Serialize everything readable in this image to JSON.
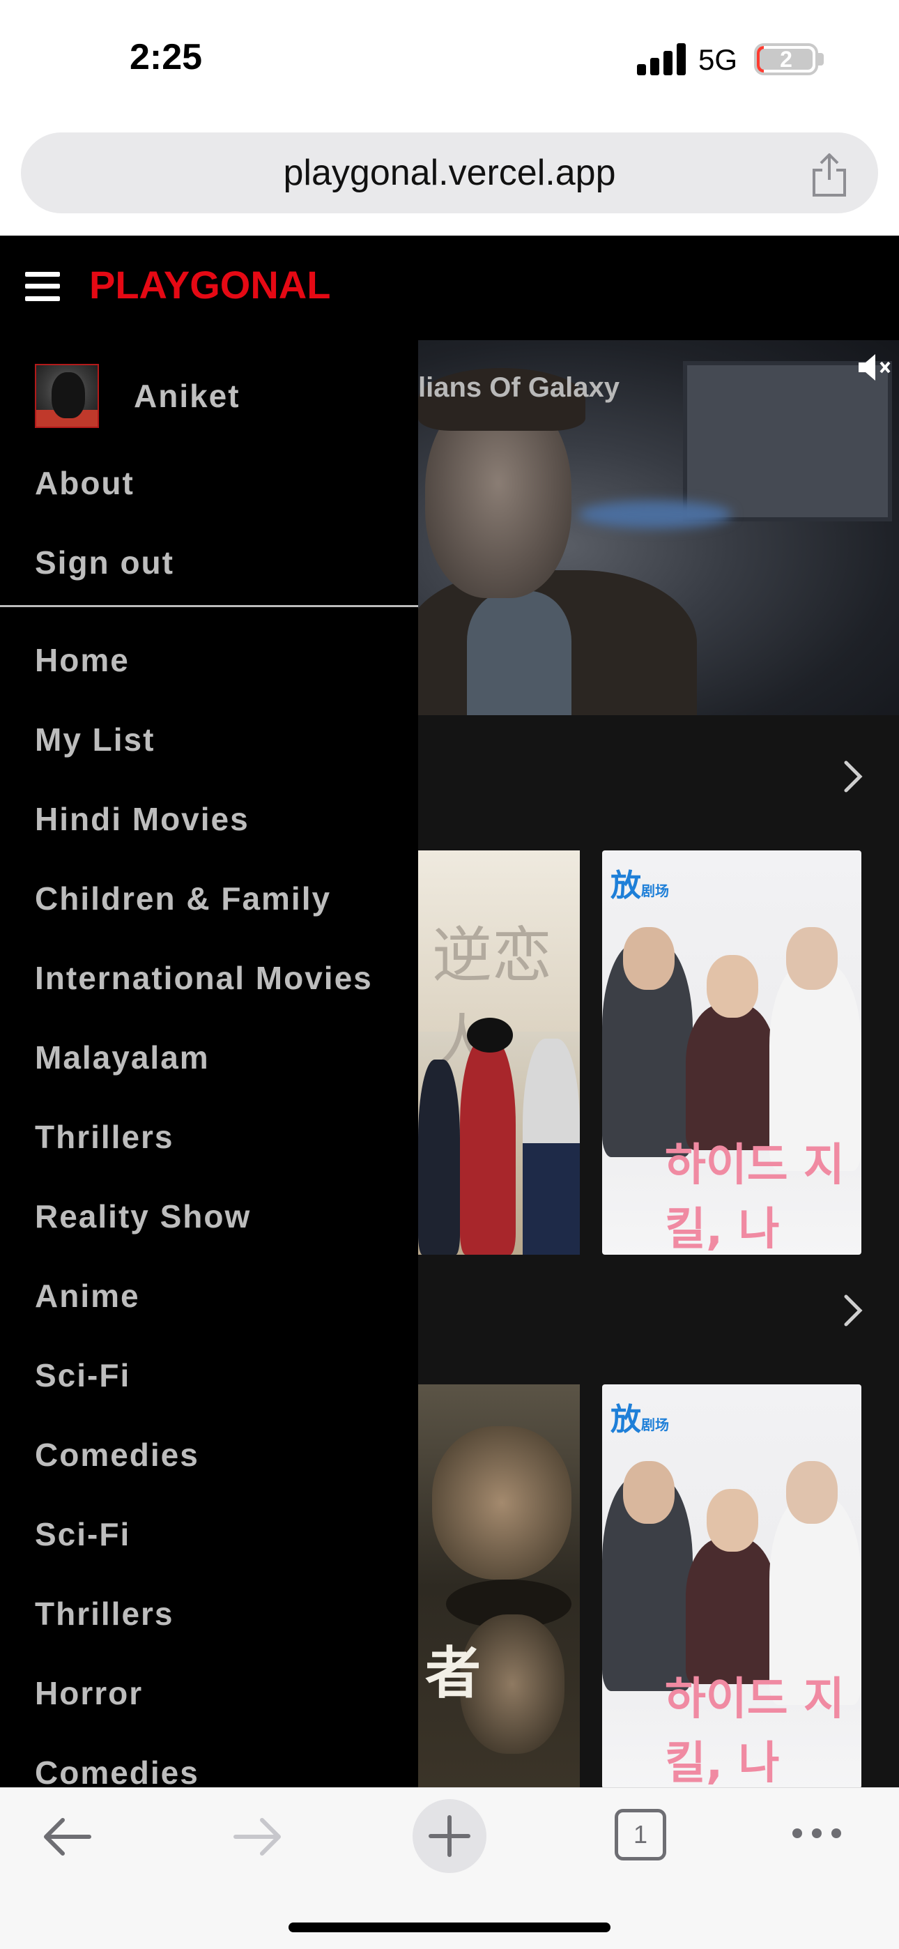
{
  "status_bar": {
    "time": "2:25",
    "network": "5G",
    "battery_level": "2",
    "battery_color": "#ff3b30"
  },
  "browser": {
    "url": "playgonal.vercel.app",
    "share_icon": "share-icon",
    "tab_count": "1"
  },
  "app": {
    "logo": "PLAYGONAL",
    "brand_color": "#e50914",
    "menu_icon": "hamburger-icon",
    "hero_title": "lians Of Galaxy",
    "mute_icon": "speaker-muted-icon"
  },
  "drawer": {
    "profile_name": "Aniket",
    "account_items": [
      {
        "label": "About"
      },
      {
        "label": "Sign out"
      }
    ],
    "nav_items": [
      {
        "label": "Home"
      },
      {
        "label": "My List"
      },
      {
        "label": "Hindi Movies"
      },
      {
        "label": "Children & Family"
      },
      {
        "label": "International Movies"
      },
      {
        "label": "Malayalam"
      },
      {
        "label": "Thrillers"
      },
      {
        "label": "Reality Show"
      },
      {
        "label": "Anime"
      },
      {
        "label": "Sci-Fi"
      },
      {
        "label": "Comedies"
      },
      {
        "label": "Sci-Fi"
      },
      {
        "label": "Thrillers"
      },
      {
        "label": "Horror"
      },
      {
        "label": "Comedies"
      }
    ]
  },
  "rows": [
    {
      "chevron_icon": "chevron-right-icon",
      "posters": [
        {
          "brand": "",
          "overlay_text": "逆恋人"
        },
        {
          "brand": "放",
          "brand_sub": "剧场",
          "overlay_text": "하이드 지킬, 나"
        }
      ]
    },
    {
      "chevron_icon": "chevron-right-icon",
      "posters": [
        {
          "brand": "",
          "overlay_text": "者"
        },
        {
          "brand": "放",
          "brand_sub": "剧场",
          "overlay_text": "하이드 지킬, 나"
        }
      ]
    }
  ],
  "toolbar": {
    "back_icon": "arrow-left-icon",
    "forward_icon": "arrow-right-icon",
    "new_tab_icon": "plus-icon",
    "tabs_icon": "tabs-icon",
    "more_icon": "more-dots-icon"
  }
}
